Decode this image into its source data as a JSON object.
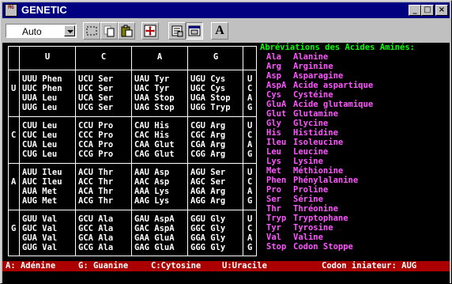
{
  "window": {
    "title": "GENETIC",
    "app_icon_text": "MG",
    "controls": {
      "minimize": "_",
      "maximize": "□",
      "close": "×"
    }
  },
  "toolbar": {
    "mode_select": "Auto",
    "font_button_glyph": "A"
  },
  "table": {
    "columns": [
      "U",
      "C",
      "A",
      "G"
    ],
    "rows": [
      {
        "first": "U",
        "third": [
          "U",
          "C",
          "A",
          "G"
        ],
        "cells": [
          [
            "UUU Phen",
            "UUC Phen",
            "UUA Leu",
            "UUG Leu"
          ],
          [
            "UCU Ser",
            "UCC Ser",
            "UCA Ser",
            "UCG Ser"
          ],
          [
            "UAU Tyr",
            "UAC Tyr",
            "UAA Stop",
            "UAG Stop"
          ],
          [
            "UGU Cys",
            "UGC Cys",
            "UGA Stop",
            "UGG Tryp"
          ]
        ]
      },
      {
        "first": "C",
        "third": [
          "U",
          "C",
          "A",
          "G"
        ],
        "cells": [
          [
            "CUU Leu",
            "CUC Leu",
            "CUA Leu",
            "CUG Leu"
          ],
          [
            "CCU Pro",
            "CCC Pro",
            "CCA Pro",
            "CCG Pro"
          ],
          [
            "CAU His",
            "CAC His",
            "CAA Glut",
            "CAG Glut"
          ],
          [
            "CGU Arg",
            "CGC Arg",
            "CGA Arg",
            "CGG Arg"
          ]
        ]
      },
      {
        "first": "A",
        "third": [
          "U",
          "C",
          "A",
          "G"
        ],
        "cells": [
          [
            "AUU Ileu",
            "AUC Ileu",
            "AUA Met",
            "AUG Met"
          ],
          [
            "ACU Thr",
            "ACC Thr",
            "ACA Thr",
            "ACG Thr"
          ],
          [
            "AAU Asp",
            "AAC Asp",
            "AAA Lys",
            "AAG Lys"
          ],
          [
            "AGU Ser",
            "AGC Ser",
            "AGA Arg",
            "AGG Arg"
          ]
        ]
      },
      {
        "first": "G",
        "third": [
          "U",
          "C",
          "A",
          "G"
        ],
        "cells": [
          [
            "GUU Val",
            "GUC Val",
            "GUA Val",
            "GUG Val"
          ],
          [
            "GCU Ala",
            "GCC Ala",
            "GCA Ala",
            "GCG Ala"
          ],
          [
            "GAU AspA",
            "GAC AspA",
            "GAA GluA",
            "GAG GluA"
          ],
          [
            "GGU Gly",
            "GGC Gly",
            "GGA Gly",
            "GGG Gly"
          ]
        ]
      }
    ]
  },
  "legend": {
    "title": "Abréviations des Acides Aminés:",
    "items": [
      {
        "abbr": "Ala",
        "name": "Alanine"
      },
      {
        "abbr": "Arg",
        "name": "Arginine"
      },
      {
        "abbr": "Asp",
        "name": "Asparagine"
      },
      {
        "abbr": "AspA",
        "name": "Acide aspartique"
      },
      {
        "abbr": "Cys",
        "name": "Cystéine"
      },
      {
        "abbr": "GluA",
        "name": "Acide glutamique"
      },
      {
        "abbr": "Glut",
        "name": "Glutamine"
      },
      {
        "abbr": "Gly",
        "name": "Glycine"
      },
      {
        "abbr": "His",
        "name": "Histidine"
      },
      {
        "abbr": "Ileu",
        "name": "Isoleucine"
      },
      {
        "abbr": "Leu",
        "name": "Leucine"
      },
      {
        "abbr": "Lys",
        "name": "Lysine"
      },
      {
        "abbr": "Met",
        "name": "Méthionine"
      },
      {
        "abbr": "Phen",
        "name": "Phénylalanine"
      },
      {
        "abbr": "Pro",
        "name": "Proline"
      },
      {
        "abbr": "Ser",
        "name": "Sérine"
      },
      {
        "abbr": "Thr",
        "name": "Thréonine"
      },
      {
        "abbr": "Tryp",
        "name": "Tryptophane"
      },
      {
        "abbr": "Tyr",
        "name": "Tyrosine"
      },
      {
        "abbr": "Val",
        "name": "Valine"
      },
      {
        "abbr": "Stop",
        "name": "Codon Stoppe"
      }
    ]
  },
  "status": {
    "adenine": "A: Adénine",
    "guanine": "G: Guanine",
    "cytosine": "C:Cytosine",
    "uracile": "U:Uracile",
    "initiator": "Codon iniateur: AUG"
  },
  "colors": {
    "background": "#000000",
    "table_text": "#ffffff",
    "legend_title": "#00ff00",
    "legend_text": "#ff55ff",
    "status_bar": "#aa0000",
    "title_bar": "#000080"
  }
}
